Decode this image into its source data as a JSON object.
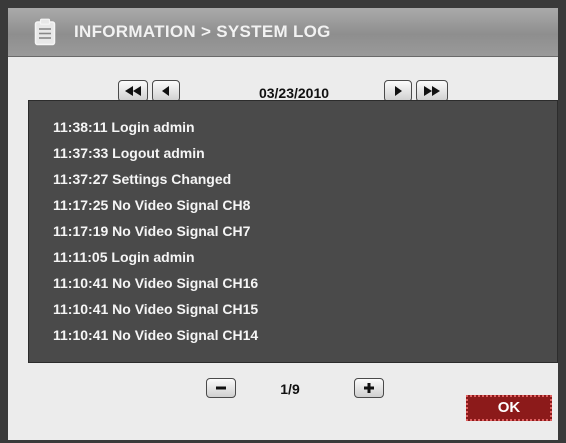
{
  "header": {
    "title": "INFORMATION > SYSTEM LOG",
    "icon": "clipboard-icon"
  },
  "date_nav": {
    "date": "03/23/2010",
    "buttons": [
      "fast-rewind-icon",
      "previous-icon",
      "next-icon",
      "fast-forward-icon"
    ]
  },
  "log": {
    "entries": [
      "11:38:11 Login admin",
      "11:37:33 Logout admin",
      "11:37:27 Settings Changed",
      "11:17:25 No Video Signal CH8",
      "11:17:19 No Video Signal CH7",
      "11:11:05 Login admin",
      "11:10:41 No Video Signal CH16",
      "11:10:41 No Video Signal CH15",
      "11:10:41 No Video Signal CH14"
    ]
  },
  "pagination": {
    "page": "1/9"
  },
  "actions": {
    "ok_label": "OK"
  },
  "colors": {
    "title_bar": "#9a9a9a",
    "panel_bg": "#4a4a4a",
    "ok_bg": "#8c1a1a"
  }
}
